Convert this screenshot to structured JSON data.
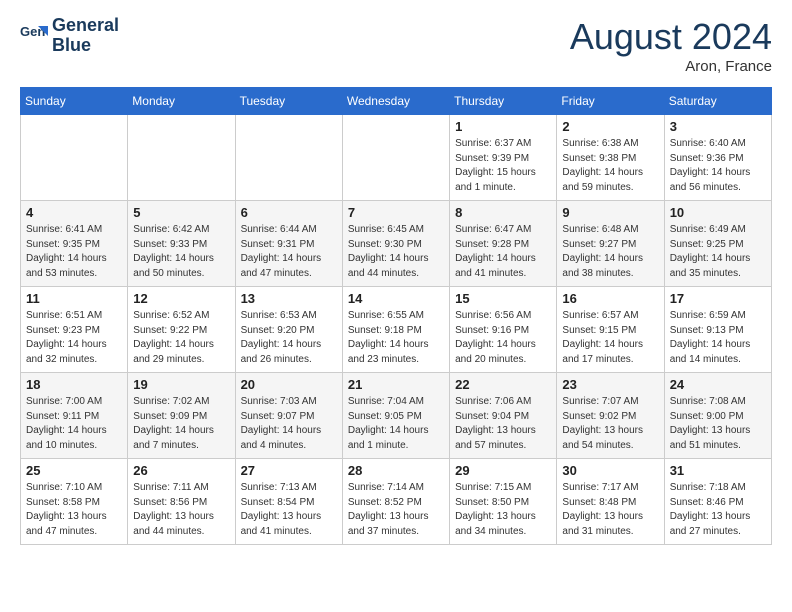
{
  "header": {
    "logo_line1": "General",
    "logo_line2": "Blue",
    "month": "August 2024",
    "location": "Aron, France"
  },
  "weekdays": [
    "Sunday",
    "Monday",
    "Tuesday",
    "Wednesday",
    "Thursday",
    "Friday",
    "Saturday"
  ],
  "weeks": [
    [
      {
        "day": "",
        "info": ""
      },
      {
        "day": "",
        "info": ""
      },
      {
        "day": "",
        "info": ""
      },
      {
        "day": "",
        "info": ""
      },
      {
        "day": "1",
        "info": "Sunrise: 6:37 AM\nSunset: 9:39 PM\nDaylight: 15 hours\nand 1 minute."
      },
      {
        "day": "2",
        "info": "Sunrise: 6:38 AM\nSunset: 9:38 PM\nDaylight: 14 hours\nand 59 minutes."
      },
      {
        "day": "3",
        "info": "Sunrise: 6:40 AM\nSunset: 9:36 PM\nDaylight: 14 hours\nand 56 minutes."
      }
    ],
    [
      {
        "day": "4",
        "info": "Sunrise: 6:41 AM\nSunset: 9:35 PM\nDaylight: 14 hours\nand 53 minutes."
      },
      {
        "day": "5",
        "info": "Sunrise: 6:42 AM\nSunset: 9:33 PM\nDaylight: 14 hours\nand 50 minutes."
      },
      {
        "day": "6",
        "info": "Sunrise: 6:44 AM\nSunset: 9:31 PM\nDaylight: 14 hours\nand 47 minutes."
      },
      {
        "day": "7",
        "info": "Sunrise: 6:45 AM\nSunset: 9:30 PM\nDaylight: 14 hours\nand 44 minutes."
      },
      {
        "day": "8",
        "info": "Sunrise: 6:47 AM\nSunset: 9:28 PM\nDaylight: 14 hours\nand 41 minutes."
      },
      {
        "day": "9",
        "info": "Sunrise: 6:48 AM\nSunset: 9:27 PM\nDaylight: 14 hours\nand 38 minutes."
      },
      {
        "day": "10",
        "info": "Sunrise: 6:49 AM\nSunset: 9:25 PM\nDaylight: 14 hours\nand 35 minutes."
      }
    ],
    [
      {
        "day": "11",
        "info": "Sunrise: 6:51 AM\nSunset: 9:23 PM\nDaylight: 14 hours\nand 32 minutes."
      },
      {
        "day": "12",
        "info": "Sunrise: 6:52 AM\nSunset: 9:22 PM\nDaylight: 14 hours\nand 29 minutes."
      },
      {
        "day": "13",
        "info": "Sunrise: 6:53 AM\nSunset: 9:20 PM\nDaylight: 14 hours\nand 26 minutes."
      },
      {
        "day": "14",
        "info": "Sunrise: 6:55 AM\nSunset: 9:18 PM\nDaylight: 14 hours\nand 23 minutes."
      },
      {
        "day": "15",
        "info": "Sunrise: 6:56 AM\nSunset: 9:16 PM\nDaylight: 14 hours\nand 20 minutes."
      },
      {
        "day": "16",
        "info": "Sunrise: 6:57 AM\nSunset: 9:15 PM\nDaylight: 14 hours\nand 17 minutes."
      },
      {
        "day": "17",
        "info": "Sunrise: 6:59 AM\nSunset: 9:13 PM\nDaylight: 14 hours\nand 14 minutes."
      }
    ],
    [
      {
        "day": "18",
        "info": "Sunrise: 7:00 AM\nSunset: 9:11 PM\nDaylight: 14 hours\nand 10 minutes."
      },
      {
        "day": "19",
        "info": "Sunrise: 7:02 AM\nSunset: 9:09 PM\nDaylight: 14 hours\nand 7 minutes."
      },
      {
        "day": "20",
        "info": "Sunrise: 7:03 AM\nSunset: 9:07 PM\nDaylight: 14 hours\nand 4 minutes."
      },
      {
        "day": "21",
        "info": "Sunrise: 7:04 AM\nSunset: 9:05 PM\nDaylight: 14 hours\nand 1 minute."
      },
      {
        "day": "22",
        "info": "Sunrise: 7:06 AM\nSunset: 9:04 PM\nDaylight: 13 hours\nand 57 minutes."
      },
      {
        "day": "23",
        "info": "Sunrise: 7:07 AM\nSunset: 9:02 PM\nDaylight: 13 hours\nand 54 minutes."
      },
      {
        "day": "24",
        "info": "Sunrise: 7:08 AM\nSunset: 9:00 PM\nDaylight: 13 hours\nand 51 minutes."
      }
    ],
    [
      {
        "day": "25",
        "info": "Sunrise: 7:10 AM\nSunset: 8:58 PM\nDaylight: 13 hours\nand 47 minutes."
      },
      {
        "day": "26",
        "info": "Sunrise: 7:11 AM\nSunset: 8:56 PM\nDaylight: 13 hours\nand 44 minutes."
      },
      {
        "day": "27",
        "info": "Sunrise: 7:13 AM\nSunset: 8:54 PM\nDaylight: 13 hours\nand 41 minutes."
      },
      {
        "day": "28",
        "info": "Sunrise: 7:14 AM\nSunset: 8:52 PM\nDaylight: 13 hours\nand 37 minutes."
      },
      {
        "day": "29",
        "info": "Sunrise: 7:15 AM\nSunset: 8:50 PM\nDaylight: 13 hours\nand 34 minutes."
      },
      {
        "day": "30",
        "info": "Sunrise: 7:17 AM\nSunset: 8:48 PM\nDaylight: 13 hours\nand 31 minutes."
      },
      {
        "day": "31",
        "info": "Sunrise: 7:18 AM\nSunset: 8:46 PM\nDaylight: 13 hours\nand 27 minutes."
      }
    ]
  ]
}
